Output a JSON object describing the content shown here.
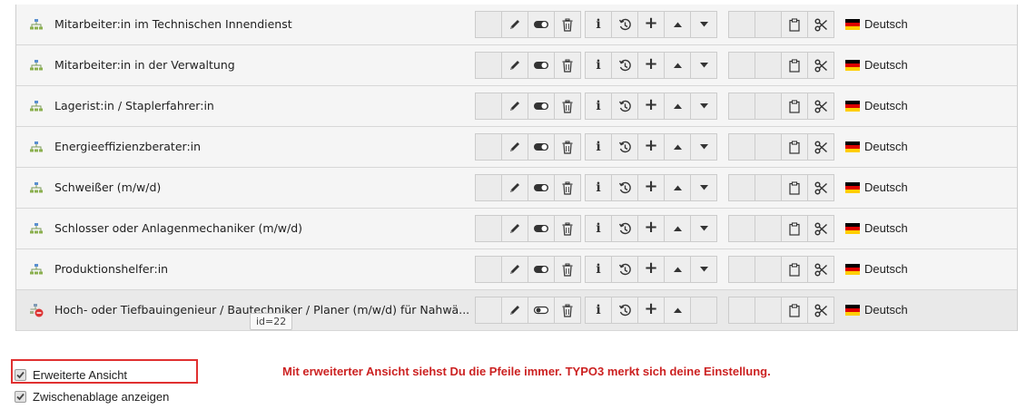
{
  "rows": [
    {
      "title": "Mitarbeiter:in im Technischen Innendienst",
      "hidden": false,
      "down_arrow": true
    },
    {
      "title": "Mitarbeiter:in in der Verwaltung",
      "hidden": false,
      "down_arrow": true
    },
    {
      "title": "Lagerist:in / Staplerfahrer:in",
      "hidden": false,
      "down_arrow": true
    },
    {
      "title": "Energieeffizienzberater:in",
      "hidden": false,
      "down_arrow": true
    },
    {
      "title": "Schweißer (m/w/d)",
      "hidden": false,
      "down_arrow": true
    },
    {
      "title": "Schlosser oder Anlagenmechaniker (m/w/d)",
      "hidden": false,
      "down_arrow": true
    },
    {
      "title": "Produktionshelfer:in",
      "hidden": false,
      "down_arrow": true
    },
    {
      "title": "Hoch- oder Tiefbauingenieur / Bautechniker / Planer (m/w/d) für Nahwä...",
      "hidden": true,
      "down_arrow": false
    }
  ],
  "icons": {
    "page": "sitemap-page-icon",
    "page_hidden": "sitemap-page-hidden-icon",
    "edit": "pencil-icon",
    "toggle": "toggle-icon",
    "delete": "trash-icon",
    "info": "info-icon",
    "history": "history-icon",
    "new": "plus-icon",
    "move_up": "arrow-up-icon",
    "move_down": "arrow-down-icon",
    "clipboard": "clipboard-icon",
    "cut": "scissors-icon",
    "language_flag": "german-flag-icon"
  },
  "language_label": "Deutsch",
  "info_label": "i",
  "new_label": "+",
  "tooltip": "id=22",
  "options": {
    "extended_view": "Erweiterte Ansicht",
    "clipboard": "Zwischenablage anzeigen"
  },
  "note": "Mit erweiterter Ansicht siehst Du die Pfeile immer. TYPO3 merkt sich deine Einstellung.",
  "colors": {
    "highlight_box": "#e03030",
    "note_text": "#cc2222",
    "row_background": "#f5f5f5"
  }
}
